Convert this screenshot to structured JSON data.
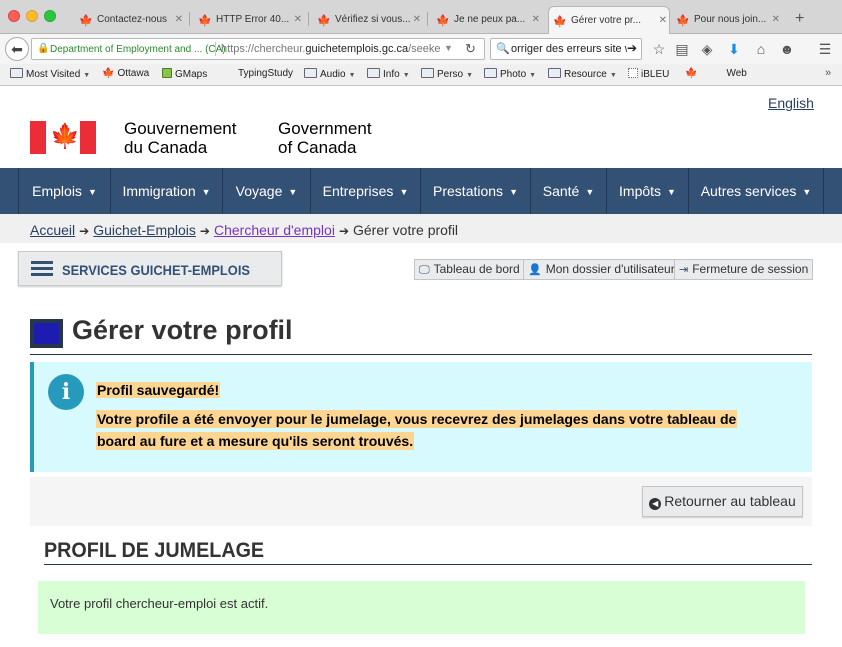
{
  "browser": {
    "tabs": [
      {
        "label": "Contactez-nous",
        "active": false
      },
      {
        "label": "HTTP Error 40...",
        "active": false
      },
      {
        "label": "Vérifiez si vous...",
        "active": false
      },
      {
        "label": "Je ne peux pa...",
        "active": false
      },
      {
        "label": "Gérer votre pr...",
        "active": true
      },
      {
        "label": "Pour nous join...",
        "active": false
      }
    ],
    "new_tab": "+",
    "close_glyph": "✕",
    "identity": "Department of Employment and ... (CA)",
    "url_prefix": "https://chercheur.",
    "url_domain": "guichetemplois.gc.ca",
    "url_suffix": "/seeker/p",
    "search_query": "orriger des erreurs site w",
    "bookmarks": [
      {
        "label": "Most Visited",
        "icon": "folder",
        "dropdown": true
      },
      {
        "label": "Ottawa",
        "icon": "maple-leaf",
        "dropdown": false
      },
      {
        "label": "GMaps",
        "icon": "gmaps",
        "dropdown": false
      },
      {
        "label": "TypingStudy",
        "icon": "none",
        "dropdown": false
      },
      {
        "label": "Audio",
        "icon": "folder",
        "dropdown": true
      },
      {
        "label": "Info",
        "icon": "folder",
        "dropdown": true
      },
      {
        "label": "Perso",
        "icon": "folder",
        "dropdown": true
      },
      {
        "label": "Photo",
        "icon": "folder",
        "dropdown": true
      },
      {
        "label": "Resource",
        "icon": "folder",
        "dropdown": true
      },
      {
        "label": "iBLEU",
        "icon": "page",
        "dropdown": false
      },
      {
        "label": "Web",
        "icon": "maple-leaf",
        "dropdown": false
      }
    ],
    "more_bookmarks": "»"
  },
  "header": {
    "language_link": "English",
    "sig_fr": "Gouvernement\ndu Canada",
    "sig_en": "Government\nof Canada"
  },
  "menu": [
    {
      "label": "Emplois"
    },
    {
      "label": "Immigration"
    },
    {
      "label": "Voyage"
    },
    {
      "label": "Entreprises"
    },
    {
      "label": "Prestations"
    },
    {
      "label": "Santé"
    },
    {
      "label": "Impôts"
    },
    {
      "label": "Autres services"
    }
  ],
  "breadcrumb": {
    "items": [
      {
        "label": "Accueil",
        "link": true
      },
      {
        "label": "Guichet-Emplois",
        "link": true
      },
      {
        "label": "Chercheur d'emploi",
        "link": true
      },
      {
        "label": "Gérer votre profil",
        "link": false
      }
    ],
    "separator": "➔"
  },
  "services": {
    "label": "SERVICES GUICHET-EMPLOIS"
  },
  "user_nav": {
    "dashboard": "Tableau de bord",
    "account": "Mon dossier d'utilisateur",
    "logout": "Fermeture de session"
  },
  "page": {
    "title": "Gérer votre profil",
    "alert_heading": "Profil sauvegardé!",
    "alert_message": "Votre profile a été envoyer pour le jumelage, vous recevrez des jumelages dans votre tableau de board au fure et a mesure qu'ils seront trouvés.",
    "back_button": "Retourner au tableau",
    "section_heading": "PROFIL DE JUMELAGE",
    "status_message": "Votre profil chercheur-emploi est actif."
  },
  "colors": {
    "menu_bg": "#335075",
    "alert_bg": "#d7faff",
    "alert_accent": "#269abc",
    "highlight": "#fcd591",
    "success_bg": "#d8fed6",
    "flag_red": "#eb2d37"
  }
}
